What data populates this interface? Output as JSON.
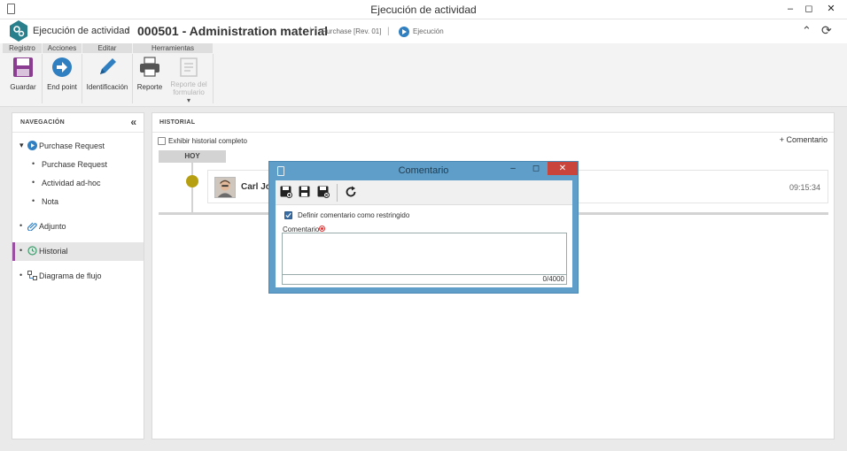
{
  "window": {
    "title": "Ejecución de actividad",
    "minimize": "–",
    "maximize": "◻",
    "close": "✕"
  },
  "header": {
    "app_title": "Ejecución de actividad",
    "chevron": "›",
    "doc_title": "000501 - Administration material",
    "separator": "|",
    "process": "Purchase [Rev. 01]",
    "status": "Ejecución",
    "collapse_glyph": "⌃",
    "refresh_glyph": "⟳"
  },
  "ribbon": {
    "groups": [
      "Registro",
      "Acciones",
      "Editar",
      "Herramientas"
    ],
    "buttons": {
      "save": "Guardar",
      "end_point": "End point",
      "identification": "Identificación",
      "report": "Reporte",
      "form_report_1": "Reporte del",
      "form_report_2": "formulario",
      "dropdown": "▾"
    }
  },
  "navigation": {
    "title": "NAVEGACIÓN",
    "collapse": "«",
    "bullet": "•",
    "expander": "▾",
    "items": [
      {
        "label": "Purchase Request"
      },
      {
        "label": "Purchase Request"
      },
      {
        "label": "Actividad ad-hoc"
      },
      {
        "label": "Nota"
      },
      {
        "label": "Adjunto"
      },
      {
        "label": "Historial"
      },
      {
        "label": "Diagrama de flujo"
      }
    ],
    "active": "Historial"
  },
  "history": {
    "title": "HISTORIAL",
    "show_all": "Exhibir historial completo",
    "show_all_checked": false,
    "add_comment": "+ Comentario",
    "group_label": "HOY",
    "entries": [
      {
        "name": "Carl Jo",
        "time": "09:15:34"
      }
    ],
    "dot_color": "#b6a012"
  },
  "dialog": {
    "title": "Comentario",
    "minimize": "–",
    "maximize": "◻",
    "close": "✕",
    "restrict_label": "Definir comentario como restringido",
    "restrict_checked": true,
    "comment_label": "Comentario",
    "comment_value": "",
    "counter": "0/4000",
    "title_color": "#5f9ec8"
  },
  "colors": {
    "active_accent": "#9b4fa3",
    "ribbon_icon_blue": "#2f7fc1",
    "save_icon": "#8b3d92",
    "close_red": "#c9453b"
  }
}
